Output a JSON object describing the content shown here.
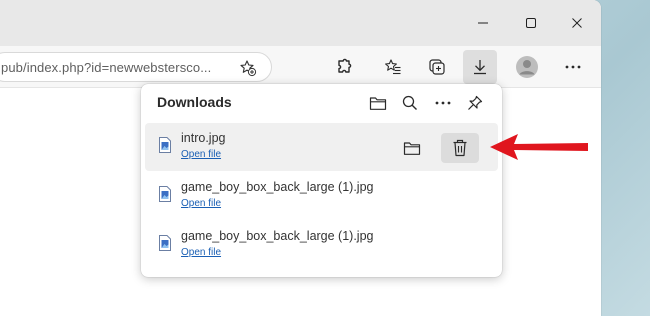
{
  "browser": {
    "address": "pub/index.php?id=newwebstersco...",
    "toolbar_icons": [
      "favorite-add-icon",
      "extensions-icon",
      "favorites-icon",
      "collections-icon",
      "downloads-icon",
      "profile-icon",
      "more-icon"
    ]
  },
  "window_controls": [
    "minimize",
    "maximize",
    "close"
  ],
  "downloads": {
    "title": "Downloads",
    "header_icons": [
      "open-folder-icon",
      "search-icon",
      "more-icon",
      "pin-icon"
    ],
    "items": [
      {
        "name": "intro.jpg",
        "action": "Open file"
      },
      {
        "name": "game_boy_box_back_large (1).jpg",
        "action": "Open file"
      },
      {
        "name": "game_boy_box_back_large (1).jpg",
        "action": "Open file"
      }
    ]
  },
  "colors": {
    "titlebar": "#e8e8e8",
    "toolbar": "#f7f7f7",
    "link": "#1a5fb4",
    "arrow": "#e0161e"
  }
}
